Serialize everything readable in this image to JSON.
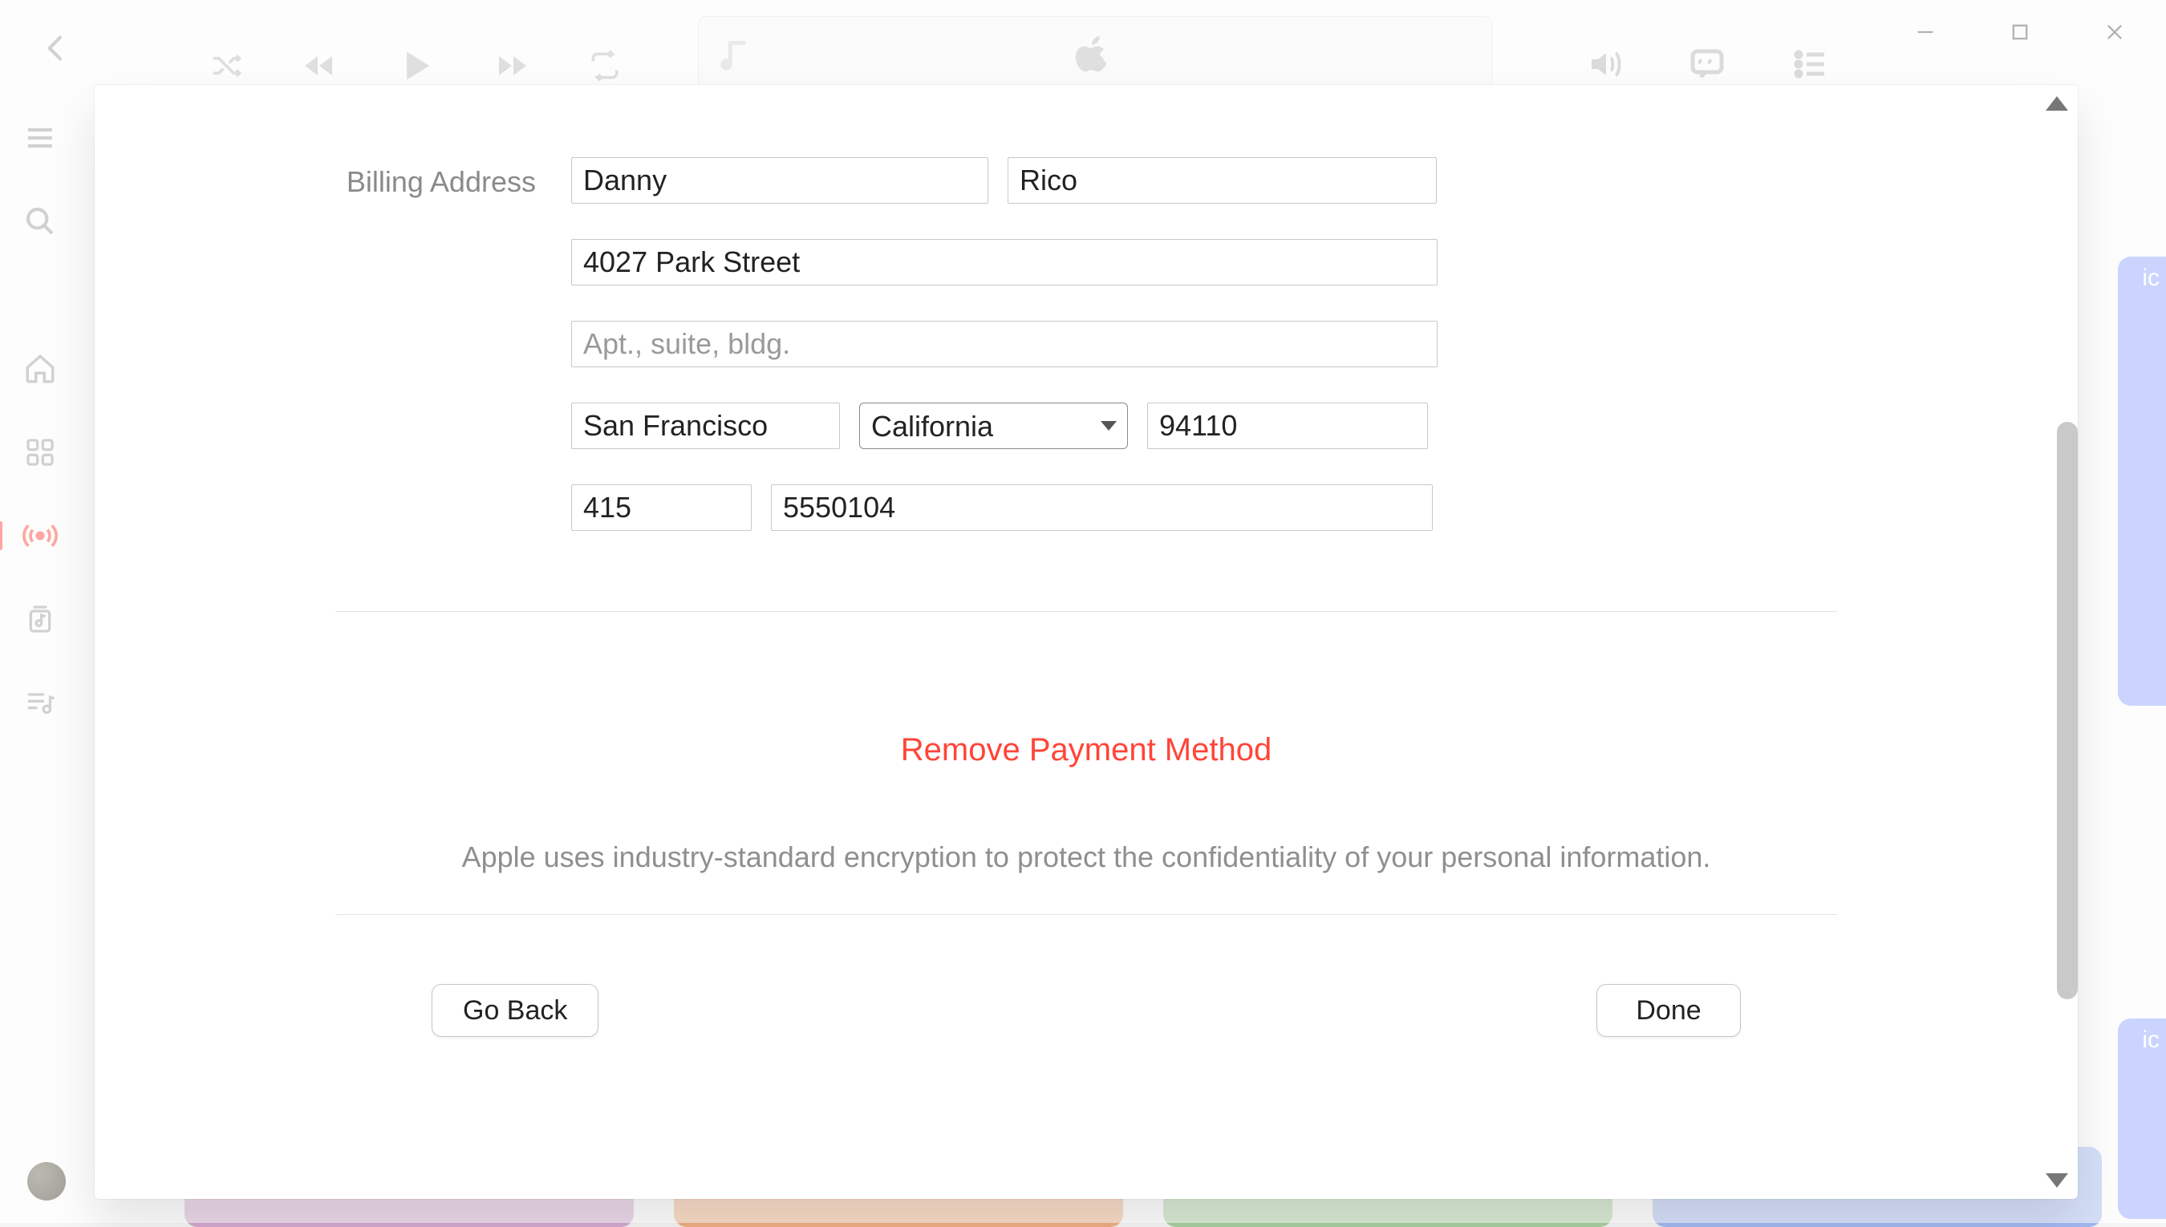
{
  "window": {
    "controls": {
      "minimize": "–",
      "maximize": "▢",
      "close": "✕"
    }
  },
  "player": {
    "icons": [
      "shuffle",
      "prev",
      "play",
      "next",
      "repeat"
    ],
    "center_logo": "apple"
  },
  "sidebar": {
    "items": [
      {
        "icon": "menu"
      },
      {
        "icon": "search"
      },
      {
        "icon": "home"
      },
      {
        "icon": "grid"
      },
      {
        "icon": "radio",
        "active": true
      },
      {
        "icon": "library"
      },
      {
        "icon": "playlist"
      }
    ]
  },
  "background_cards": {
    "side_label_1": "ic",
    "side_label_2": "ic"
  },
  "sheet": {
    "section_label": "Billing Address",
    "fields": {
      "first_name": "Danny",
      "last_name": "Rico",
      "street": "4027 Park Street",
      "apt_placeholder": "Apt., suite, bldg.",
      "apt": "",
      "city": "San Francisco",
      "state": "California",
      "zip": "94110",
      "area_code": "415",
      "phone": "5550104"
    },
    "remove_link": "Remove Payment Method",
    "disclaimer": "Apple uses industry-standard encryption to protect the confidentiality of your personal information.",
    "buttons": {
      "back": "Go Back",
      "done": "Done"
    }
  }
}
